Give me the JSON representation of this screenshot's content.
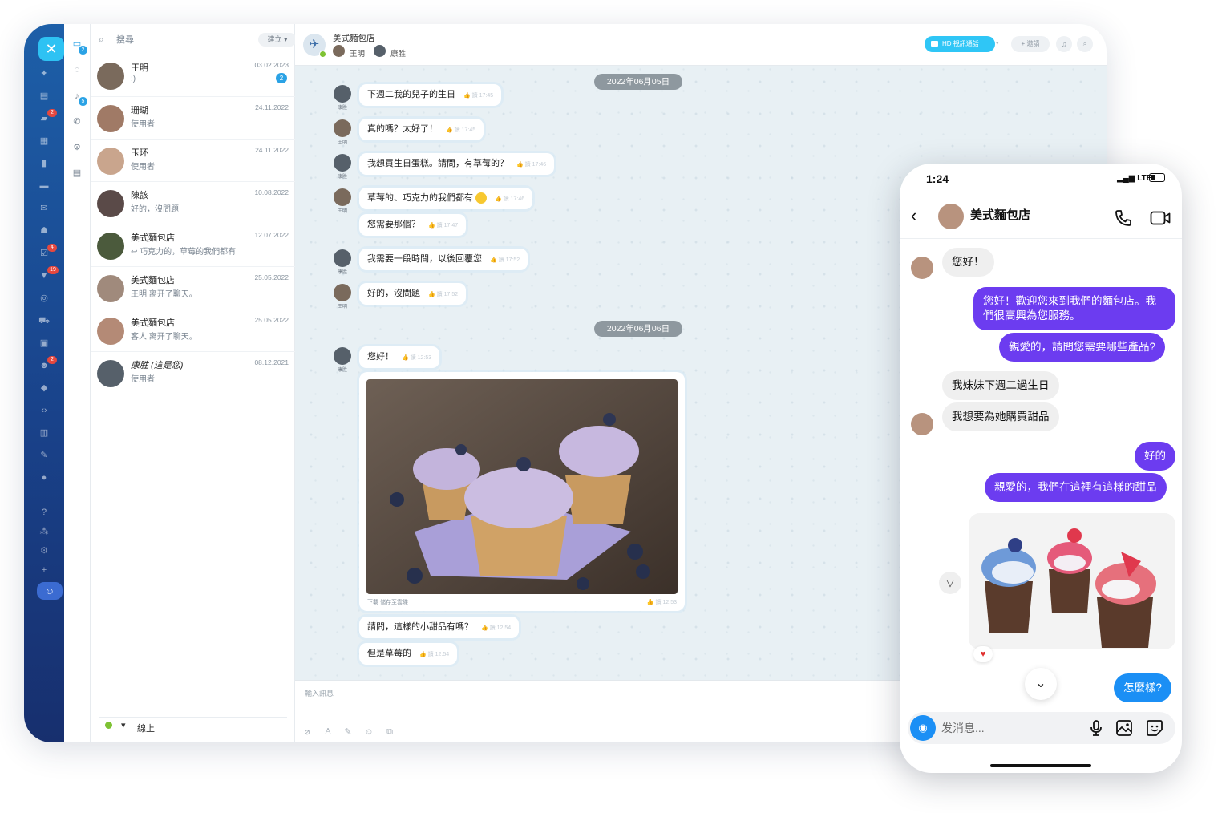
{
  "desktop": {
    "left_rail": {
      "badges": [
        "2",
        "4",
        "19",
        "2"
      ]
    },
    "sub_rail": {
      "badges": [
        "2",
        "5"
      ]
    },
    "contacts": {
      "search_placeholder": "搜尋",
      "create_label": "建立",
      "items": [
        {
          "name": "王明",
          "sub": ":)",
          "date": "03.02.2023",
          "unread": "2",
          "color": "#7a6a5c"
        },
        {
          "name": "珊瑚",
          "sub": "使用者",
          "date": "24.11.2022",
          "color": "#a07a66"
        },
        {
          "name": "玉环",
          "sub": "使用者",
          "date": "24.11.2022",
          "color": "#c9a58d"
        },
        {
          "name": "陳該",
          "sub": "好的，沒問題",
          "date": "10.08.2022",
          "color": "#5a4a48"
        },
        {
          "name": "美式麵包店",
          "sub": "↩ 巧克力的，草莓的我們都有",
          "date": "12.07.2022",
          "color": "#4b5a3c"
        },
        {
          "name": "美式麵包店",
          "sub": "王明 离开了聊天。",
          "date": "25.05.2022",
          "color": "#a08a7c"
        },
        {
          "name": "美式麵包店",
          "sub": "客人 离开了聊天。",
          "date": "25.05.2022",
          "color": "#b48a76"
        },
        {
          "name": "康胜 (這是您)",
          "sub": "使用者",
          "date": "08.12.2021",
          "color": "#56606a"
        }
      ],
      "status_label": "線上"
    },
    "chat": {
      "title": "美式麵包店",
      "members": [
        "王明",
        "康胜"
      ],
      "hd_button": "HD 視訊通話",
      "invite_button": "+ 邀請",
      "date_1": "2022年06月05日",
      "date_2": "2022年06月06日",
      "messages": [
        {
          "text": "下週二我的兒子的生日",
          "time": "17:45",
          "avatar_name": "康胜"
        },
        {
          "text": "真的嗎？太好了！",
          "time": "17:45",
          "avatar_name": "王明"
        },
        {
          "text": "我想買生日蛋糕。請問，有草莓的？",
          "time": "17:46",
          "avatar_name": "康胜"
        },
        {
          "text": "草莓的、巧克力的我們都有",
          "time": "17:46",
          "avatar_name": "王明"
        },
        {
          "text": "您需要那個？",
          "time": "17:47",
          "avatar_name": ""
        },
        {
          "text": "我需要一段時間，以後回覆您",
          "time": "17:52",
          "avatar_name": "康胜"
        },
        {
          "text": "好的，沒問題",
          "time": "17:52",
          "avatar_name": "王明"
        },
        {
          "text": "您好！",
          "time": "12:53",
          "avatar_name": "康胜"
        },
        {
          "text": "請問，這樣的小甜品有嗎？",
          "time": "12:54",
          "avatar_name": ""
        },
        {
          "text": "但是草莓的",
          "time": "12:54",
          "avatar_name": ""
        }
      ],
      "image_actions": "下載  儲存至雲碟",
      "image_time": "12:53",
      "composer_placeholder": "輸入訊息"
    }
  },
  "phone": {
    "time": "1:24",
    "network": "LTE",
    "title": "美式麵包店",
    "messages": [
      {
        "text": "您好！",
        "dir": "in"
      },
      {
        "text": "您好！歡迎您來到我們的麵包店。我們很高興為您服務。",
        "dir": "out"
      },
      {
        "text": "親愛的，請問您需要哪些產品?",
        "dir": "out"
      },
      {
        "text": "我妹妹下週二過生日",
        "dir": "in"
      },
      {
        "text": "我想要為她購買甜品",
        "dir": "in"
      },
      {
        "text": "好的",
        "dir": "out"
      },
      {
        "text": "親愛的，我們在這裡有這樣的甜品",
        "dir": "out"
      },
      {
        "text": "怎麼樣?",
        "dir": "out"
      }
    ],
    "composer_placeholder": "发消息...",
    "colors": {
      "outgoing": "#6c3cf0",
      "own": "#1b8ff5",
      "incoming": "#efefef"
    }
  }
}
